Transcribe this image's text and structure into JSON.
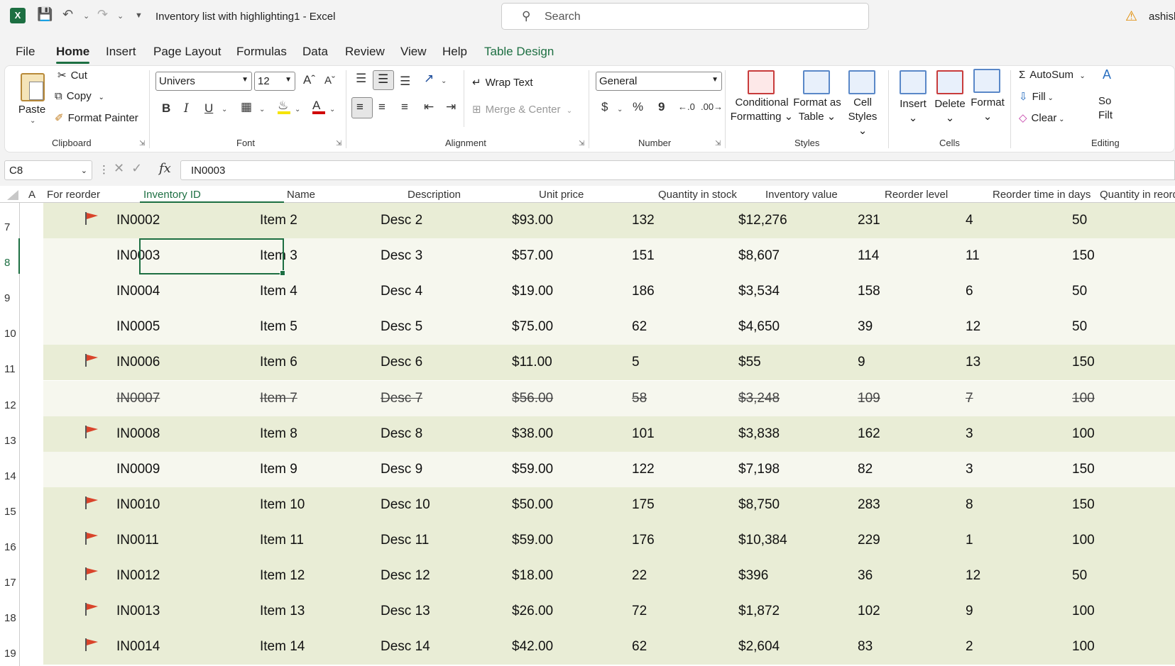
{
  "app": {
    "title": "Inventory list with highlighting1  -  Excel",
    "search_placeholder": "Search",
    "user": "ashish",
    "logo": "X"
  },
  "tabs": [
    "File",
    "Home",
    "Insert",
    "Page Layout",
    "Formulas",
    "Data",
    "Review",
    "View",
    "Help",
    "Table Design"
  ],
  "ribbon": {
    "clipboard": {
      "paste": "Paste",
      "cut": "Cut",
      "copy": "Copy",
      "format_painter": "Format Painter",
      "label": "Clipboard"
    },
    "font": {
      "name": "Univers",
      "size": "12",
      "label": "Font",
      "bold": "B",
      "italic": "I",
      "underline": "U"
    },
    "alignment": {
      "wrap_text": "Wrap Text",
      "merge_center": "Merge & Center",
      "label": "Alignment"
    },
    "number": {
      "format": "General",
      "label": "Number",
      "currency": "$",
      "percent": "%",
      "comma": "9"
    },
    "styles": {
      "conditional": "Conditional",
      "formatting": "Formatting",
      "format_as": "Format as",
      "table": "Table",
      "cell": "Cell",
      "styles": "Styles",
      "label": "Styles"
    },
    "cells": {
      "insert": "Insert",
      "delete": "Delete",
      "format": "Format",
      "label": "Cells"
    },
    "editing": {
      "autosum": "AutoSum",
      "fill": "Fill",
      "clear": "Clear",
      "sort": "So",
      "filter": "Filt",
      "label": "Editing"
    }
  },
  "formula_bar": {
    "name_box": "C8",
    "value": "IN0003",
    "fx": "fx"
  },
  "columns": [
    "A",
    "For reorder",
    "Inventory ID",
    "Name",
    "Description",
    "Unit price",
    "Quantity  in stock",
    "Inventory value",
    "Reorder level",
    "Reorder time in days",
    "Quantity  in reorder"
  ],
  "rows": [
    {
      "num": "7",
      "flag": true,
      "id": "IN0002",
      "name": "Item 2",
      "desc": "Desc 2",
      "price": "$93.00",
      "qty": "132",
      "value": "$12,276",
      "reorder": "231",
      "days": "4",
      "qreorder": "50"
    },
    {
      "num": "8",
      "flag": false,
      "id": "IN0003",
      "name": "Item 3",
      "desc": "Desc 3",
      "price": "$57.00",
      "qty": "151",
      "value": "$8,607",
      "reorder": "114",
      "days": "11",
      "qreorder": "150"
    },
    {
      "num": "9",
      "flag": false,
      "id": "IN0004",
      "name": "Item 4",
      "desc": "Desc 4",
      "price": "$19.00",
      "qty": "186",
      "value": "$3,534",
      "reorder": "158",
      "days": "6",
      "qreorder": "50"
    },
    {
      "num": "10",
      "flag": false,
      "id": "IN0005",
      "name": "Item 5",
      "desc": "Desc 5",
      "price": "$75.00",
      "qty": "62",
      "value": "$4,650",
      "reorder": "39",
      "days": "12",
      "qreorder": "50"
    },
    {
      "num": "11",
      "flag": true,
      "id": "IN0006",
      "name": "Item 6",
      "desc": "Desc 6",
      "price": "$11.00",
      "qty": "5",
      "value": "$55",
      "reorder": "9",
      "days": "13",
      "qreorder": "150"
    },
    {
      "num": "12",
      "flag": false,
      "id": "IN0007",
      "name": "Item 7",
      "desc": "Desc 7",
      "price": "$56.00",
      "qty": "58",
      "value": "$3,248",
      "reorder": "109",
      "days": "7",
      "qreorder": "100"
    },
    {
      "num": "13",
      "flag": true,
      "id": "IN0008",
      "name": "Item 8",
      "desc": "Desc 8",
      "price": "$38.00",
      "qty": "101",
      "value": "$3,838",
      "reorder": "162",
      "days": "3",
      "qreorder": "100"
    },
    {
      "num": "14",
      "flag": false,
      "id": "IN0009",
      "name": "Item 9",
      "desc": "Desc 9",
      "price": "$59.00",
      "qty": "122",
      "value": "$7,198",
      "reorder": "82",
      "days": "3",
      "qreorder": "150"
    },
    {
      "num": "15",
      "flag": true,
      "id": "IN0010",
      "name": "Item 10",
      "desc": "Desc 10",
      "price": "$50.00",
      "qty": "175",
      "value": "$8,750",
      "reorder": "283",
      "days": "8",
      "qreorder": "150"
    },
    {
      "num": "16",
      "flag": true,
      "id": "IN0011",
      "name": "Item 11",
      "desc": "Desc 11",
      "price": "$59.00",
      "qty": "176",
      "value": "$10,384",
      "reorder": "229",
      "days": "1",
      "qreorder": "100"
    },
    {
      "num": "17",
      "flag": true,
      "id": "IN0012",
      "name": "Item 12",
      "desc": "Desc 12",
      "price": "$18.00",
      "qty": "22",
      "value": "$396",
      "reorder": "36",
      "days": "12",
      "qreorder": "50"
    },
    {
      "num": "18",
      "flag": true,
      "id": "IN0013",
      "name": "Item 13",
      "desc": "Desc 13",
      "price": "$26.00",
      "qty": "72",
      "value": "$1,872",
      "reorder": "102",
      "days": "9",
      "qreorder": "100"
    },
    {
      "num": "19",
      "flag": true,
      "id": "IN0014",
      "name": "Item 14",
      "desc": "Desc 14",
      "price": "$42.00",
      "qty": "62",
      "value": "$2,604",
      "reorder": "83",
      "days": "2",
      "qreorder": "100"
    }
  ],
  "row_styles": {
    "discontinued_row": "12",
    "selected_row": "8",
    "band_color": "#e9edd6",
    "light_color": "#f6f7ee",
    "accent": "#1d6f42",
    "flag_color": "#d9442b"
  },
  "icons": [
    "excel-icon",
    "save-icon",
    "undo-icon",
    "redo-icon",
    "search-icon",
    "warning-icon",
    "flag-icon"
  ]
}
